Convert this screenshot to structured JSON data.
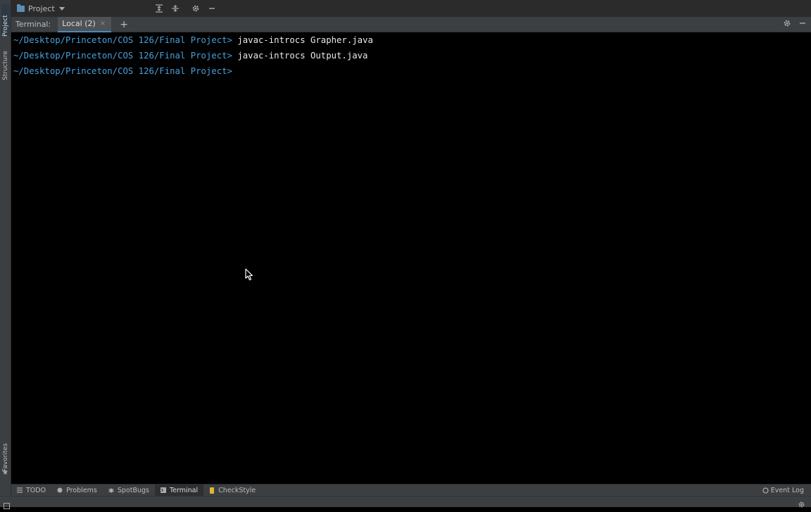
{
  "left_strip": {
    "project_label": "Project",
    "structure_label": "Structure",
    "favorites_label": "Favorites"
  },
  "top_bar": {
    "project_selector": "Project"
  },
  "terminal_bar": {
    "label": "Terminal:",
    "tab_label": "Local (2)",
    "tab_close": "×",
    "add_tab": "+"
  },
  "terminal": {
    "lines": [
      {
        "prompt": "~/Desktop/Princeton/COS 126/Final Project>",
        "command": " javac-introcs Grapher.java"
      },
      {
        "prompt": "~/Desktop/Princeton/COS 126/Final Project>",
        "command": " javac-introcs Output.java"
      },
      {
        "prompt": "~/Desktop/Princeton/COS 126/Final Project>",
        "command": ""
      }
    ]
  },
  "bottom_tools": [
    {
      "label": "TODO",
      "icon": "list-icon"
    },
    {
      "label": "Problems",
      "icon": "problems-icon"
    },
    {
      "label": "SpotBugs",
      "icon": "bug-icon"
    },
    {
      "label": "Terminal",
      "icon": "terminal-icon",
      "active": true
    },
    {
      "label": "CheckStyle",
      "icon": "checkstyle-icon"
    }
  ],
  "event_log": "Event Log",
  "colors": {
    "prompt": "#4aa0dc",
    "command": "#eaeaea",
    "background": "#000000",
    "panel": "#3c3f41",
    "accent": "#4a88c7"
  }
}
